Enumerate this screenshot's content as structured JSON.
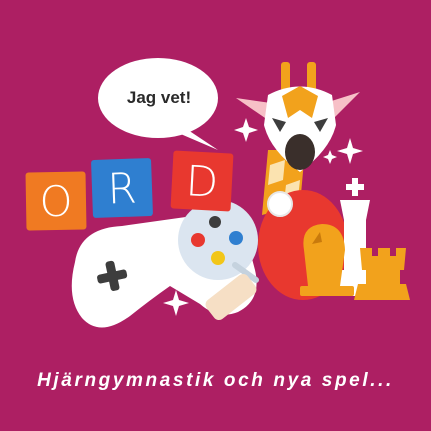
{
  "speech_bubble": {
    "text": "Jag vet!"
  },
  "word_tiles": [
    {
      "letter": "O",
      "color": "#f07a22"
    },
    {
      "letter": "R",
      "color": "#2f7fd0"
    },
    {
      "letter": "D",
      "color": "#e8382f"
    }
  ],
  "caption": {
    "text": "Hjärngymnastik och nya spel..."
  },
  "colors": {
    "background": "#ad1f63",
    "giraffe": "#f2a21c",
    "paddle": "#e8382f",
    "chess_white": "#ffffff",
    "chess_orange": "#f2a21c",
    "controller": "#ffffff"
  },
  "icons": [
    "speech-bubble-icon",
    "giraffe-icon",
    "game-controller-icon",
    "ping-pong-paddle-icon",
    "chess-king-icon",
    "chess-knight-icon",
    "chess-rook-icon",
    "sparkle-icon",
    "palette-icon"
  ]
}
